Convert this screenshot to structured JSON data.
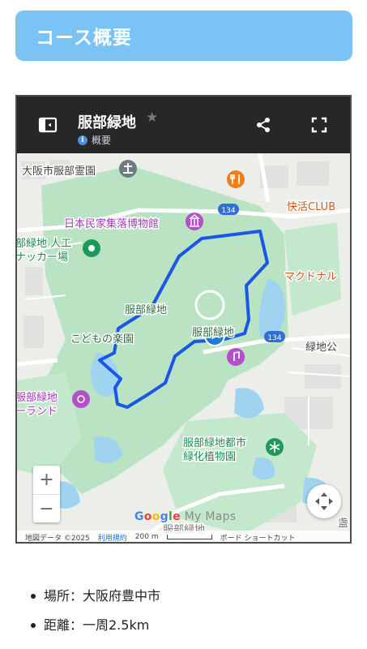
{
  "header": {
    "title": "コース概要"
  },
  "map": {
    "title": "服部緑地",
    "overview_label": "概要",
    "labels": {
      "cemetery": "大阪市服部霊園",
      "folk_museum": "日本民家集落博物館",
      "route_134_a": "134",
      "route_134_b": "134",
      "club": "快活CLUB",
      "mcdonalds": "マクドナル",
      "soccer_1": "部緑地 人工",
      "soccer_2": "ナッカー場",
      "park_main": "服部緑地",
      "kids_park": "こどもの楽園",
      "park_east": "服部緑地",
      "park_bottom": "服部緑地",
      "greenland_1": "服部緑地",
      "greenland_2": "ーランド",
      "ryokuchi_right": "緑地公",
      "botanical_1": "服部緑地都市",
      "botanical_2": "緑化植物園",
      "bottom_right": "盏"
    },
    "attribution": {
      "data": "地図データ ©2025",
      "terms": "利用規約",
      "scale": "200 m",
      "shortcuts": "ボード ショートカット"
    },
    "google_logo": {
      "google": "Google",
      "my_maps": " My Maps"
    }
  },
  "facts": [
    {
      "text": "場所：大阪府豊中市"
    },
    {
      "text": "距離：一周2.5km"
    }
  ],
  "colors": {
    "header_bg": "#7cc3f5",
    "route": "#1a56e8",
    "park_green": "#b9e3c2",
    "water": "#9fd3f0"
  }
}
